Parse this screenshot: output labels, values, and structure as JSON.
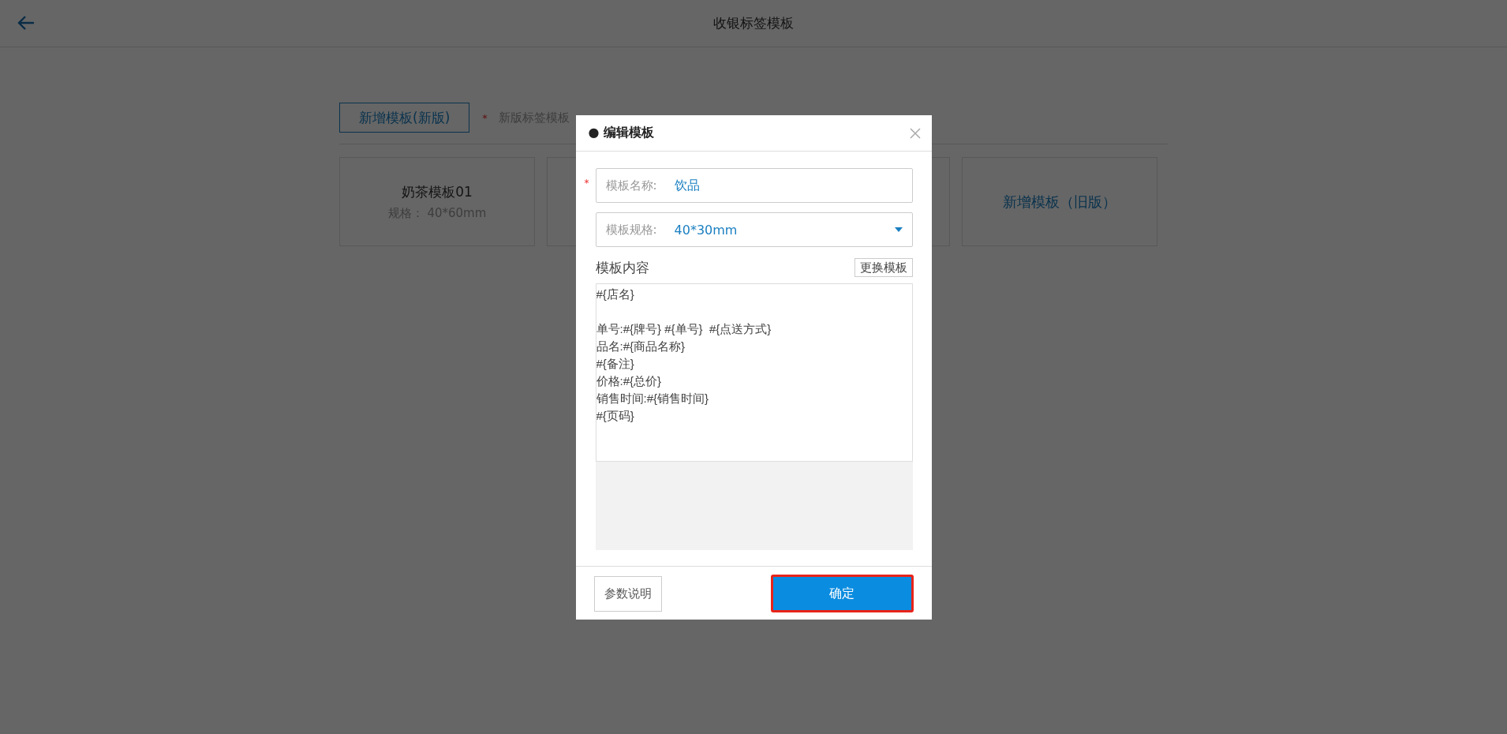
{
  "header": {
    "title": "收银标签模板"
  },
  "toolbar": {
    "add_button": "新增模板(新版)",
    "notice_mark": "*",
    "notice": "新版标签模板"
  },
  "cards": [
    {
      "kind": "template",
      "name": "奶茶模板01",
      "spec_label": "规格：",
      "spec_value": "40*60mm"
    },
    {
      "kind": "covered"
    },
    {
      "kind": "covered"
    },
    {
      "kind": "add",
      "label": "新增模板（旧版）"
    }
  ],
  "dialog": {
    "title_bullet": "●",
    "title": "编辑模板",
    "name_field": {
      "required_mark": "*",
      "label": "模板名称:",
      "value": "饮品"
    },
    "spec_field": {
      "label": "模板规格:",
      "value": "40*30mm"
    },
    "content_label": "模板内容",
    "replace_button": "更换模板",
    "content": "#{店名}\n\n单号:#{牌号} #{单号}  #{点送方式}\n品名:#{商品名称}\n#{备注}\n价格:#{总价}\n销售时间:#{销售时间}\n#{页码}",
    "help_button": "参数说明",
    "confirm_button": "确定",
    "confirm_highlighted": true
  }
}
